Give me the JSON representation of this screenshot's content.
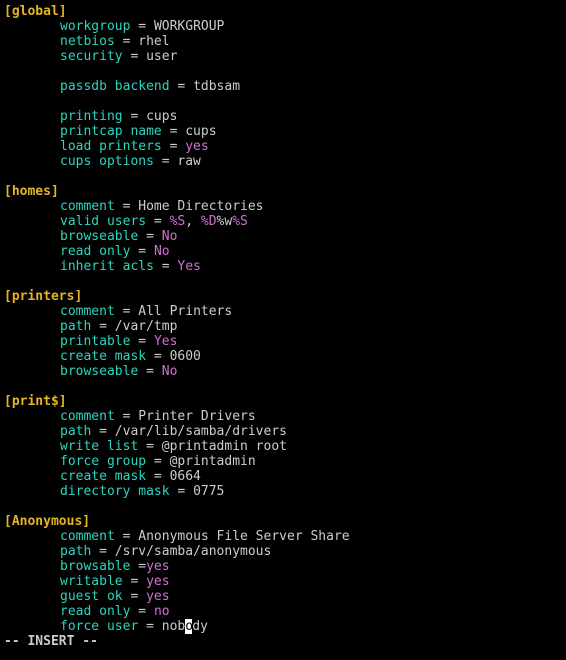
{
  "mode_line": "-- INSERT --",
  "sections": [
    {
      "name": "global",
      "header": "[global]",
      "entries": [
        {
          "key": "workgroup",
          "value": "WORKGROUP"
        },
        {
          "key": "netbios",
          "value": "rhel"
        },
        {
          "key": "security",
          "value": "user"
        },
        {
          "blank": true
        },
        {
          "key": "passdb backend",
          "value": "tdbsam"
        },
        {
          "blank": true
        },
        {
          "key": "printing",
          "value": "cups"
        },
        {
          "key": "printcap name",
          "value": "cups"
        },
        {
          "key": "load printers",
          "value": "yes",
          "bool": true
        },
        {
          "key": "cups options",
          "value": "raw"
        }
      ]
    },
    {
      "name": "homes",
      "header": "[homes]",
      "entries": [
        {
          "key": "comment",
          "value": "Home Directories"
        },
        {
          "key": "valid users",
          "macros": [
            "%S",
            "%D%w%S"
          ],
          "sep": ", "
        },
        {
          "key": "browseable",
          "value": "No",
          "bool": true
        },
        {
          "key": "read only",
          "value": "No",
          "bool": true
        },
        {
          "key": "inherit acls",
          "value": "Yes",
          "bool": true
        }
      ]
    },
    {
      "name": "printers",
      "header": "[printers]",
      "entries": [
        {
          "key": "comment",
          "value": "All Printers"
        },
        {
          "key": "path",
          "value": "/var/tmp"
        },
        {
          "key": "printable",
          "value": "Yes",
          "bool": true
        },
        {
          "key": "create mask",
          "value": "0600"
        },
        {
          "key": "browseable",
          "value": "No",
          "bool": true
        }
      ]
    },
    {
      "name": "print$",
      "header": "[print$]",
      "entries": [
        {
          "key": "comment",
          "value": "Printer Drivers"
        },
        {
          "key": "path",
          "value": "/var/lib/samba/drivers"
        },
        {
          "key": "write list",
          "value": "@printadmin root"
        },
        {
          "key": "force group",
          "value": "@printadmin"
        },
        {
          "key": "create mask",
          "value": "0664"
        },
        {
          "key": "directory mask",
          "value": "0775"
        }
      ]
    },
    {
      "name": "Anonymous",
      "header": "[Anonymous]",
      "entries": [
        {
          "key": "comment",
          "value": "Anonymous File Server Share"
        },
        {
          "key": "path",
          "value": "/srv/samba/anonymous"
        },
        {
          "key": "browsable",
          "value": "yes",
          "bool": true,
          "nospace": true
        },
        {
          "key": "writable",
          "value": "yes",
          "bool": true
        },
        {
          "key": "guest ok",
          "value": "yes",
          "bool": true
        },
        {
          "key": "read only",
          "value": "no",
          "bool": true
        },
        {
          "key": "force user",
          "value_pre": "nob",
          "cursor_char": "o",
          "value_post": "dy"
        }
      ]
    }
  ],
  "macro_parts": {
    "S": {
      "pct": "%",
      "letter": "S"
    },
    "Dw": {
      "pct1": "%",
      "D": "D",
      "w": "%w",
      "pct2": "%",
      "S": "S"
    }
  }
}
